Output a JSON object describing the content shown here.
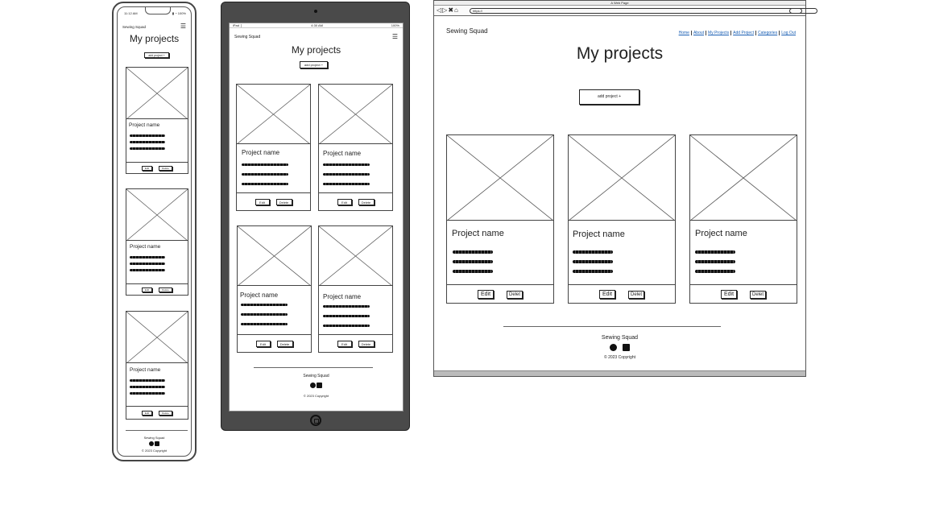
{
  "brand": "Sewing Squad",
  "heading": "My projects",
  "add_button": "add project +",
  "project_name": "Project name",
  "edit_label": "Edit",
  "delete_label": "Delete",
  "desktop_delete_label": "Delet",
  "footer_brand": "Sewing Squad",
  "copyright": "2023 Copyright",
  "copyright_symbol": "©",
  "menu_icon": "hamburger-menu-icon",
  "phone": {
    "time": "11:12 AM",
    "status": "▮ ◔ 100%"
  },
  "tablet": {
    "status_left": "iPad ❘",
    "status_mid": "4:30 AM",
    "status_right": "100%"
  },
  "browser": {
    "window_title": "A Web Page",
    "url": "https://",
    "nav": [
      "Home",
      "About",
      "My Projects",
      "Add Project",
      "Categories",
      "Log Out"
    ]
  }
}
